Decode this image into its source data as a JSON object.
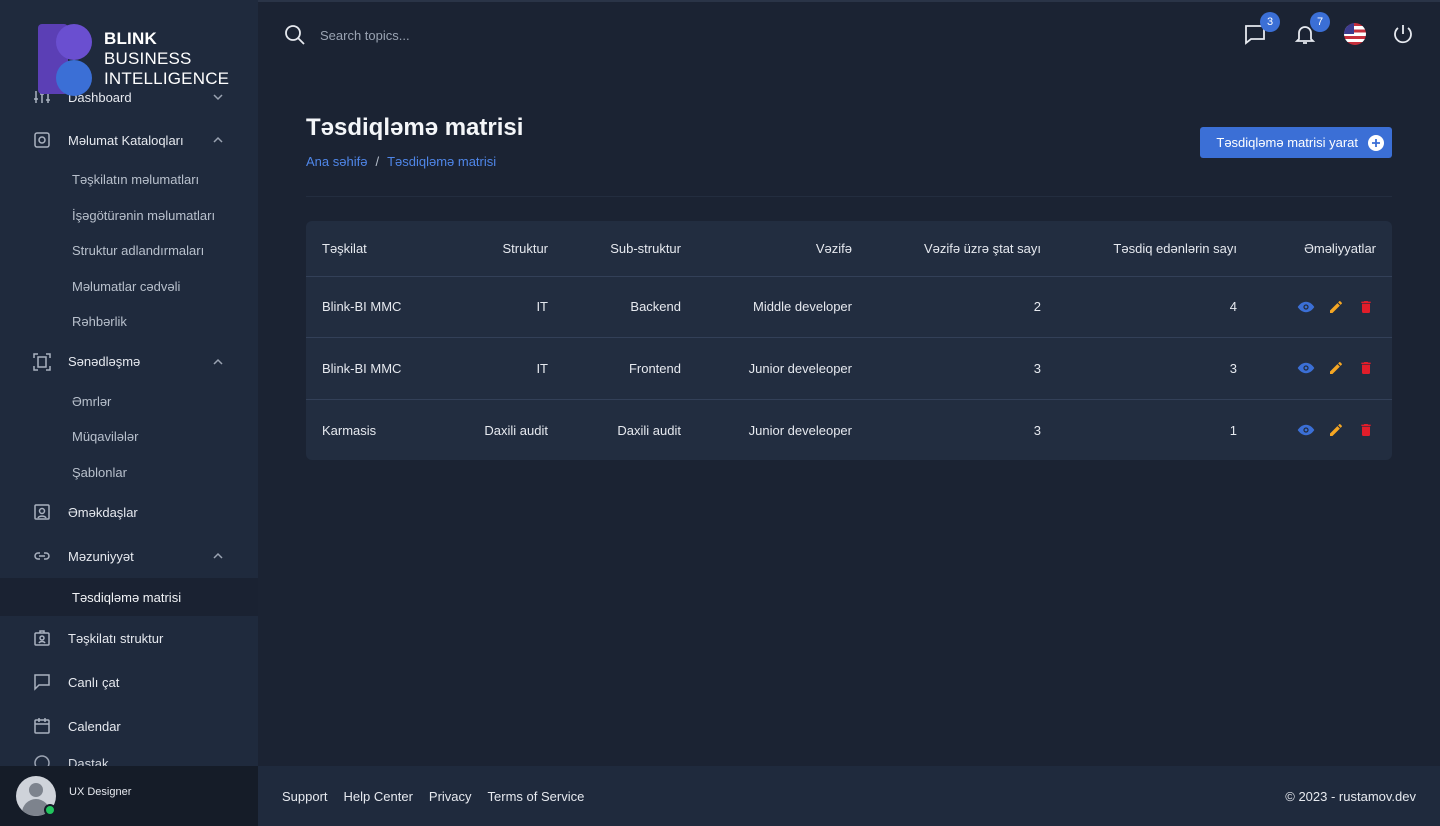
{
  "brand": {
    "line1": "BLINK",
    "line2": "BUSINESS",
    "line3": "INTELLIGENCE"
  },
  "sidebar": {
    "items": [
      {
        "label": "Dashboard",
        "icon": "sliders-icon"
      },
      {
        "label": "Məlumat Kataloqları",
        "icon": "settings-box-icon"
      },
      {
        "label": "Sənədləşmə",
        "icon": "document-scan-icon"
      },
      {
        "label": "Əməkdaşlar",
        "icon": "person-card-icon"
      },
      {
        "label": "Məzuniyyət",
        "icon": "link-icon"
      },
      {
        "label": "Təşkilatı struktur",
        "icon": "id-badge-icon"
      },
      {
        "label": "Canlı çat",
        "icon": "chat-icon"
      },
      {
        "label": "Calendar",
        "icon": "calendar-icon"
      },
      {
        "label": "Dastak ..",
        "icon": "help-icon"
      }
    ],
    "catalog_sub": [
      "Təşkilatın məlumatları",
      "İşəgötürənin məlumatları",
      "Struktur adlandırmaları",
      "Məlumatlar cədvəli",
      "Rəhbərlik"
    ],
    "docs_sub": [
      "Əmrlər",
      "Müqavilələr",
      "Şablonlar"
    ],
    "leave_sub": [
      "Təsdiqləmə matrisi"
    ]
  },
  "user": {
    "name": "UX Designer"
  },
  "topbar": {
    "search_placeholder": "Search topics...",
    "messages_count": "3",
    "notifications_count": "7"
  },
  "page": {
    "title": "Təsdiqləmə matrisi",
    "breadcrumb_home": "Ana səhifə",
    "breadcrumb_sep": "/",
    "breadcrumb_current": "Təsdiqləmə matrisi",
    "create_button": "Təsdiqləmə matrisi yarat"
  },
  "table": {
    "headers": [
      "Təşkilat",
      "Struktur",
      "Sub-struktur",
      "Vəzifə",
      "Vəzifə üzrə ştat sayı",
      "Təsdiq edənlərin sayı",
      "Əməliyyatlar"
    ],
    "rows": [
      [
        "Blink-BI MMC",
        "IT",
        "Backend",
        "Middle developer",
        "2",
        "4"
      ],
      [
        "Blink-BI MMC",
        "IT",
        "Frontend",
        "Junior develeoper",
        "3",
        "3"
      ],
      [
        "Karmasis",
        "Daxili audit",
        "Daxili audit",
        "Junior develeoper",
        "3",
        "1"
      ]
    ]
  },
  "footer": {
    "links": [
      "Support",
      "Help Center",
      "Privacy",
      "Terms of Service"
    ],
    "copyright": "© 2023 - rustamov.dev"
  },
  "colors": {
    "accent": "#3b6fd6",
    "view": "#3b6fd6",
    "edit": "#f5a623",
    "delete": "#e11d2a"
  }
}
